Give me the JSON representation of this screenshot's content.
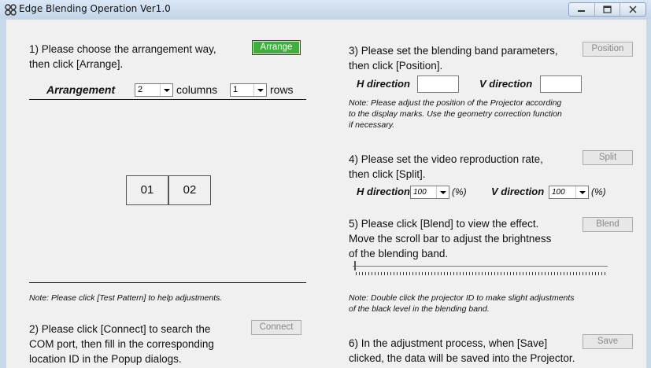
{
  "window": {
    "title": "Edge Blending Operation Ver1.0",
    "app_icon": "projector-grid-icon",
    "controls": [
      "minimize-icon",
      "maximize-icon",
      "close-icon"
    ]
  },
  "step1": {
    "text1": "1) Please choose the arrangement way,",
    "text2": "then click [Arrange].",
    "button": "Arrange",
    "arrangement_label": "Arrangement",
    "columns_value": "2",
    "columns_label": "columns",
    "rows_value": "1",
    "rows_label": "rows",
    "cells": [
      "01",
      "02"
    ],
    "note": "Note: Please click [Test Pattern] to help adjustments."
  },
  "step2": {
    "text1": "2) Please click [Connect] to search the",
    "text2": "COM port, then fill in the corresponding",
    "text3": "location ID in the Popup dialogs.",
    "button": "Connect"
  },
  "step3": {
    "text1": "3) Please set the blending band parameters,",
    "text2": "then click [Position].",
    "button": "Position",
    "h_label": "H direction",
    "v_label": "V direction",
    "h_value": "",
    "v_value": "",
    "note1": "Note: Please adjust the position of the Projector according",
    "note2": "to the display marks. Use the geometry correction function",
    "note3": "if necessary."
  },
  "step4": {
    "text1": "4) Please set the video reproduction rate,",
    "text2": "then click [Split].",
    "button": "Split",
    "h_label": "H direction",
    "h_value": "100",
    "h_unit": "(%)",
    "v_label": "V direction",
    "v_value": "100",
    "v_unit": "(%)"
  },
  "step5": {
    "text1": "5) Please click [Blend] to view the effect.",
    "text2": "Move the scroll bar to adjust the brightness",
    "text3": "of the blending band.",
    "button": "Blend",
    "slider_level": 0,
    "note1": "Note: Double click the projector ID to make slight adjustments",
    "note2": "of the black level in the blending band."
  },
  "step6": {
    "text1": "6) In the adjustment process, when [Save]",
    "text2": "clicked, the data will be saved into the Projector.",
    "button": "Save"
  }
}
